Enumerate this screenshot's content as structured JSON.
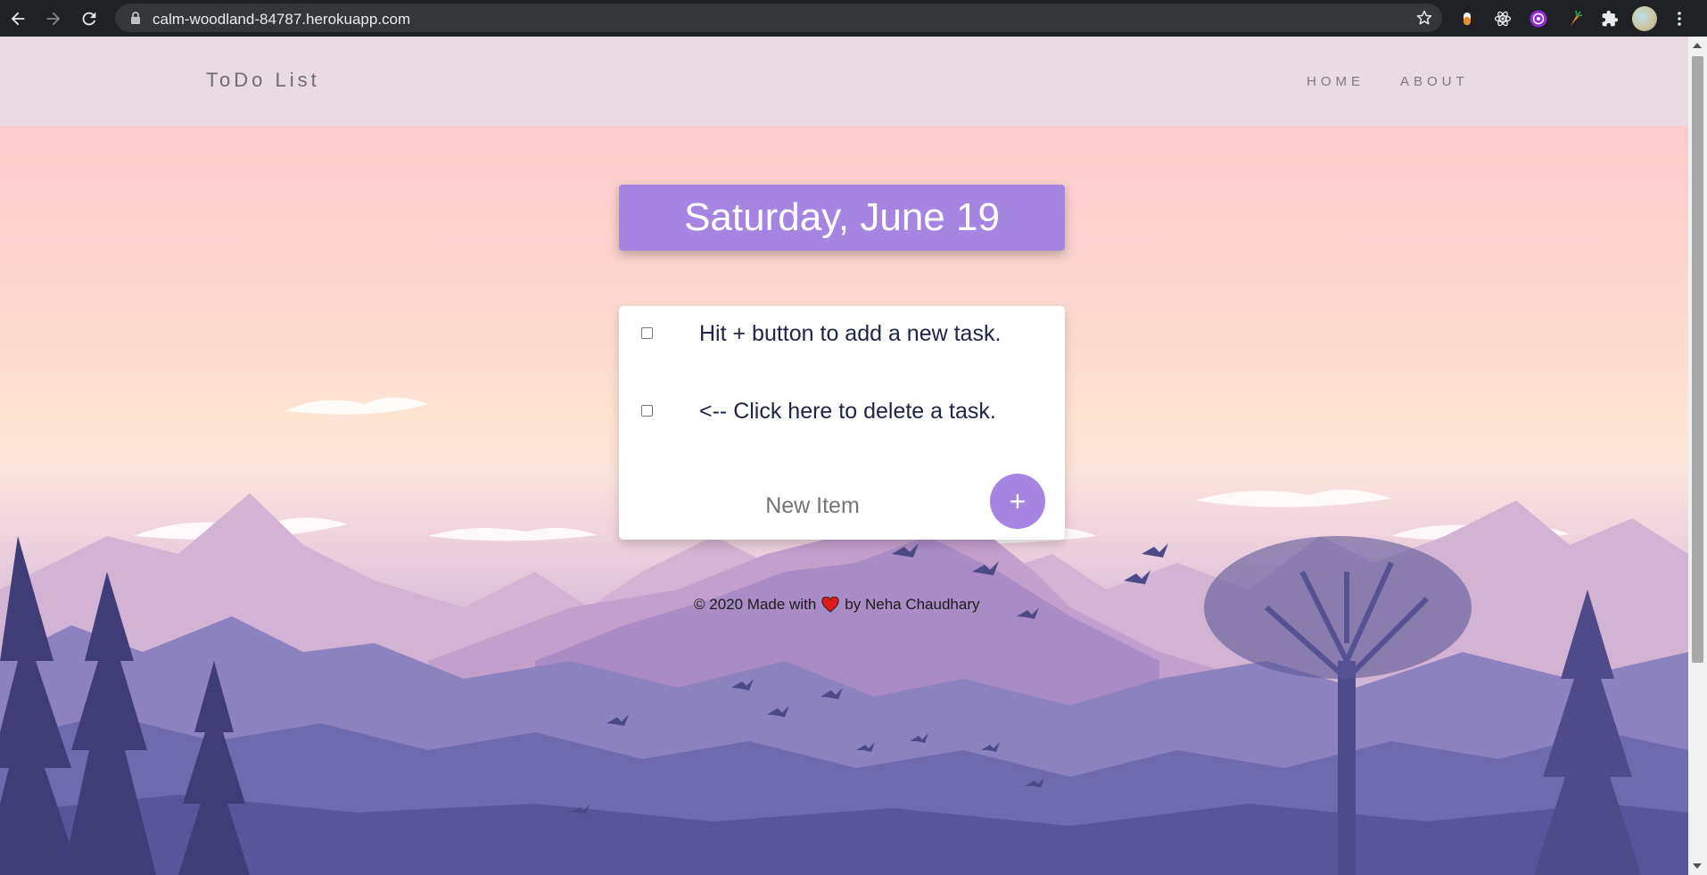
{
  "browser": {
    "url": "calm-woodland-84787.herokuapp.com",
    "icons": [
      "back-icon",
      "forward-icon",
      "reload-icon",
      "lock-icon",
      "star-icon",
      "menu-icon"
    ],
    "extensions": [
      "pepper-extension-icon",
      "react-devtools-icon",
      "github-extension-icon",
      "carrot-extension-icon",
      "puzzle-extensions-icon"
    ]
  },
  "navbar": {
    "brand": "ToDo List",
    "links": [
      "HOME",
      "ABOUT"
    ]
  },
  "date": "Saturday, June 19",
  "tasks": [
    {
      "text": "Hit + button to add a new task.",
      "checked": false
    },
    {
      "text": "<-- Click here to delete a task.",
      "checked": false
    }
  ],
  "new_item": {
    "placeholder": "New Item",
    "add_label": "+"
  },
  "footer": {
    "before": "© 2020 Made with",
    "after": "by Neha Chaudhary"
  },
  "colors": {
    "accent": "#a685e2",
    "navbar": "#eadae3",
    "chrome": "#202124"
  }
}
